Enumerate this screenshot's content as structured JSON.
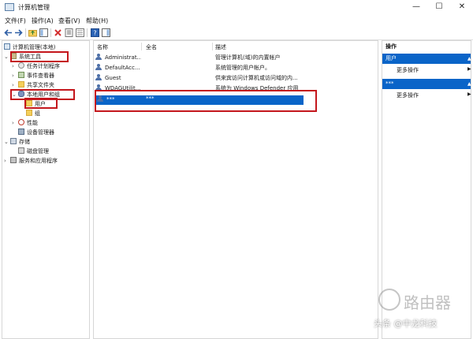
{
  "window": {
    "title": "计算机管理",
    "controls": {
      "minimize": "—",
      "maximize": "☐",
      "close": "✕"
    }
  },
  "menu": [
    "文件(F)",
    "操作(A)",
    "查看(V)",
    "帮助(H)"
  ],
  "toolbar_icons": [
    "back-arrow-icon",
    "forward-arrow-icon",
    "up-folder-icon",
    "show-hide-tree-icon",
    "delete-icon",
    "properties-icon",
    "export-list-icon",
    "help-icon",
    "show-action-pane-icon"
  ],
  "tree": {
    "root": "计算机管理(本地)",
    "system_tools": "系统工具",
    "task_scheduler": "任务计划程序",
    "event_viewer": "事件查看器",
    "shared_folders": "共享文件夹",
    "local_users_groups": "本地用户和组",
    "users": "用户",
    "groups": "组",
    "performance": "性能",
    "device_manager": "设备管理器",
    "storage": "存储",
    "disk_management": "磁盘管理",
    "services_apps": "服务和应用程序"
  },
  "list": {
    "columns": [
      "名称",
      "全名",
      "描述"
    ],
    "rows": [
      {
        "name": "Administrat...",
        "fullname": "",
        "desc": "管理计算机(域)的内置帐户"
      },
      {
        "name": "DefaultAcc...",
        "fullname": "",
        "desc": "系统管理的用户帐户。"
      },
      {
        "name": "Guest",
        "fullname": "",
        "desc": "供来宾访问计算机或访问域的内..."
      },
      {
        "name": "WDAGUtilit...",
        "fullname": "",
        "desc": "系统为 Windows Defender 应用"
      }
    ],
    "selected": {
      "name": "***",
      "fullname": "***"
    }
  },
  "actions": {
    "header": "操作",
    "section1": "用户",
    "more1": "更多操作",
    "section2": "***",
    "more2": "更多操作"
  },
  "watermark": {
    "big": "路由器",
    "small": "头条 @中龙科技"
  }
}
